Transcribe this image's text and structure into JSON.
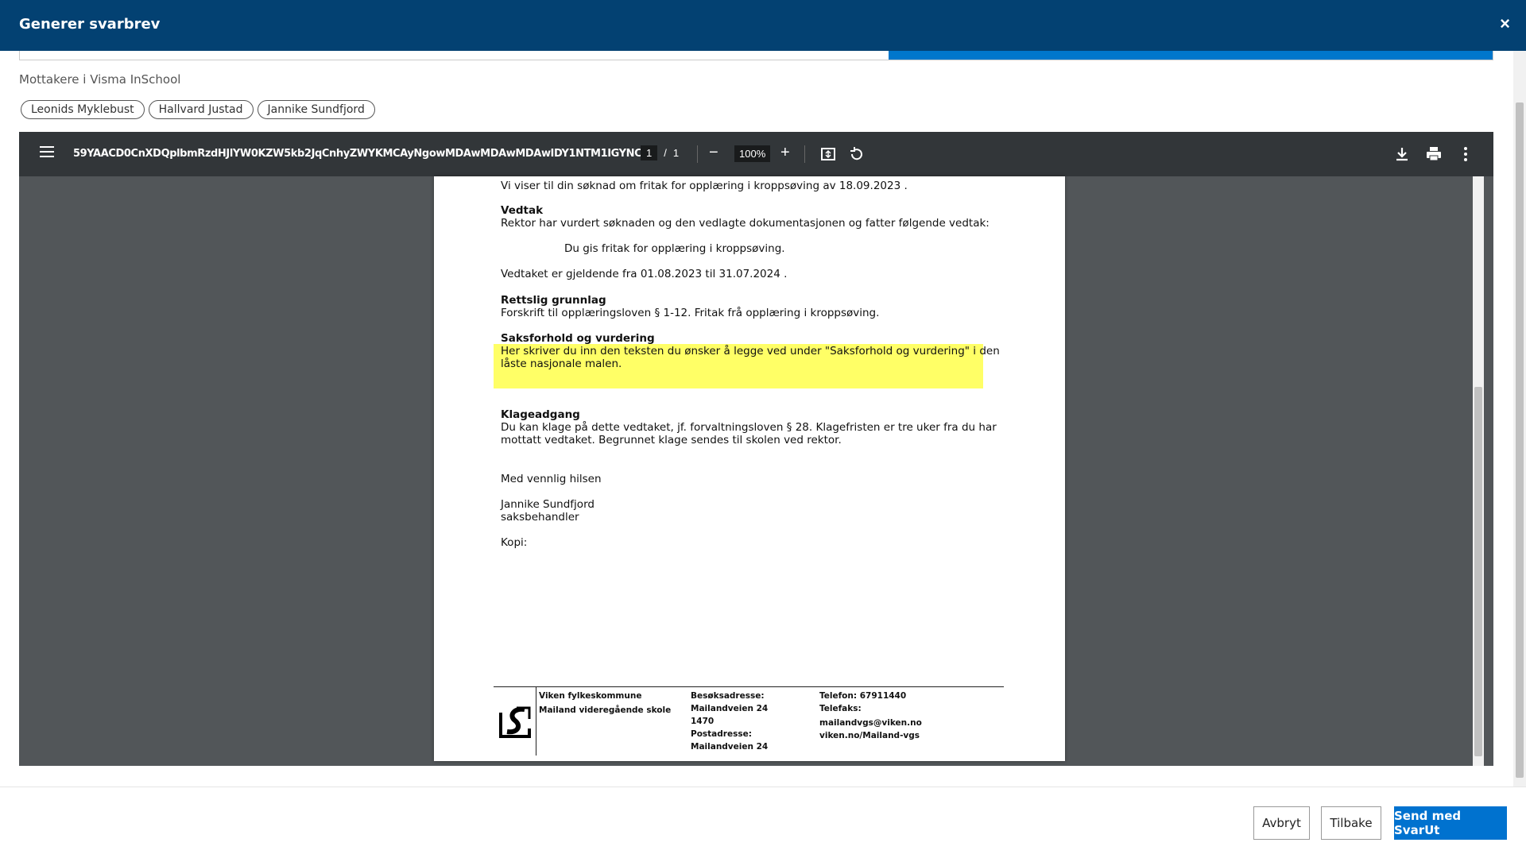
{
  "header": {
    "title": "Generer svarbrev",
    "close_label": "×"
  },
  "progress": {
    "fraction": 0.41
  },
  "recipients": {
    "label": "Mottakere i Visma InSchool",
    "chips": [
      "Leonids Myklebust",
      "Hallvard Justad",
      "Jannike Sundfjord"
    ]
  },
  "pdf_toolbar": {
    "filename": "59YAACD0CnXDQplbmRzdHJlYW0KZW5kb2JqCnhyZWYKMCAyNgowMDAwMDAwMDAwIDY1NTM1IGYNCj...",
    "page_current": "1",
    "page_separator": "/",
    "page_total": "1",
    "zoom": "100%",
    "zoom_out": "−",
    "zoom_in": "+"
  },
  "letter": {
    "intro": "Vi viser til din søknad om fritak for opplæring i kroppsøving av 18.09.2023 .",
    "vedtak_heading": "Vedtak",
    "vedtak_text": "Rektor har vurdert søknaden og den vedlagte dokumentasjonen og fatter følgende vedtak:",
    "vedtak_decision": "Du gis fritak for opplæring i kroppsøving.",
    "vedtak_validity": "Vedtaket er gjeldende fra 01.08.2023 til 31.07.2024 .",
    "grunnlag_heading": "Rettslig grunnlag",
    "grunnlag_text": "Forskrift til opplæringsloven § 1-12. Fritak frå opplæring i kroppsøving.",
    "saksforhold_heading": "Saksforhold og vurdering",
    "saksforhold_line1": "Her skriver du inn den teksten du ønsker å legge ved under \"Saksforhold og vurdering\" i den",
    "saksforhold_line2": "låste nasjonale malen.",
    "klage_heading": "Klageadgang",
    "klage_line1": "Du kan klage på dette vedtaket, jf. forvaltningsloven § 28. Klagefristen er tre uker fra du har",
    "klage_line2": "mottatt vedtaket. Begrunnet klage sendes til skolen ved rektor.",
    "greeting": "Med vennlig hilsen",
    "signer_name": "Jannike Sundfjord",
    "signer_role": "saksbehandler",
    "copy_label": "Kopi:"
  },
  "letter_footer": {
    "org1": "Viken fylkeskommune",
    "org2": "Mailand videregående skole",
    "visit_label": "Besøksadresse:",
    "visit_street": "Mailandveien 24",
    "visit_zip": "1470",
    "post_label": "Postadresse:",
    "post_street": "Mailandveien 24",
    "phone": "Telefon: 67911440",
    "fax": "Telefaks:",
    "email": "mailandvgs@viken.no",
    "web": "viken.no/Mailand-vgs"
  },
  "buttons": {
    "cancel": "Avbryt",
    "back": "Tilbake",
    "send": "Send med SvarUt"
  },
  "colors": {
    "header_bg": "#034172",
    "primary": "#0072cf",
    "highlight": "#ffff66"
  }
}
